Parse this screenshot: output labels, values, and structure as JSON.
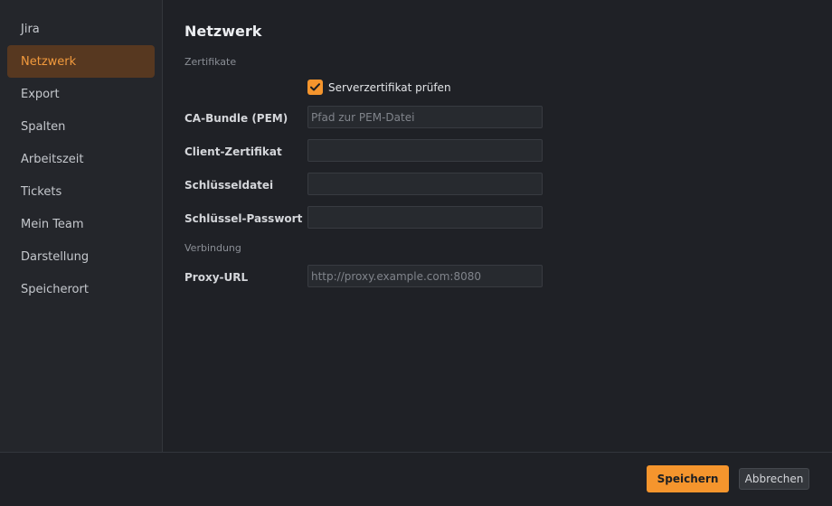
{
  "sidebar": {
    "items": [
      {
        "label": "Jira"
      },
      {
        "label": "Netzwerk",
        "active": true
      },
      {
        "label": "Export"
      },
      {
        "label": "Spalten"
      },
      {
        "label": "Arbeitszeit"
      },
      {
        "label": "Tickets"
      },
      {
        "label": "Mein Team"
      },
      {
        "label": "Darstellung"
      },
      {
        "label": "Speicherort"
      }
    ]
  },
  "main": {
    "title": "Netzwerk",
    "certificates_section": "Zertifikate",
    "verify_checkbox": {
      "label": "Serverzertifikat prüfen",
      "checked": true
    },
    "ca_bundle": {
      "label": "CA-Bundle (PEM)",
      "value": "",
      "placeholder": "Pfad zur PEM-Datei"
    },
    "client_cert": {
      "label": "Client-Zertifikat",
      "value": "",
      "placeholder": ""
    },
    "key_file": {
      "label": "Schlüsseldatei",
      "value": "",
      "placeholder": ""
    },
    "key_password": {
      "label": "Schlüssel-Passwort",
      "value": "",
      "placeholder": ""
    },
    "connection_section": "Verbindung",
    "proxy_url": {
      "label": "Proxy-URL",
      "value": "",
      "placeholder": "http://proxy.example.com:8080"
    }
  },
  "footer": {
    "save_label": "Speichern",
    "cancel_label": "Abbrechen"
  },
  "colors": {
    "accent": "#f5952d",
    "active_nav_bg": "#573820",
    "active_nav_text": "#f29a3d",
    "background": "#1f2126",
    "sidebar_bg": "#24262b"
  }
}
